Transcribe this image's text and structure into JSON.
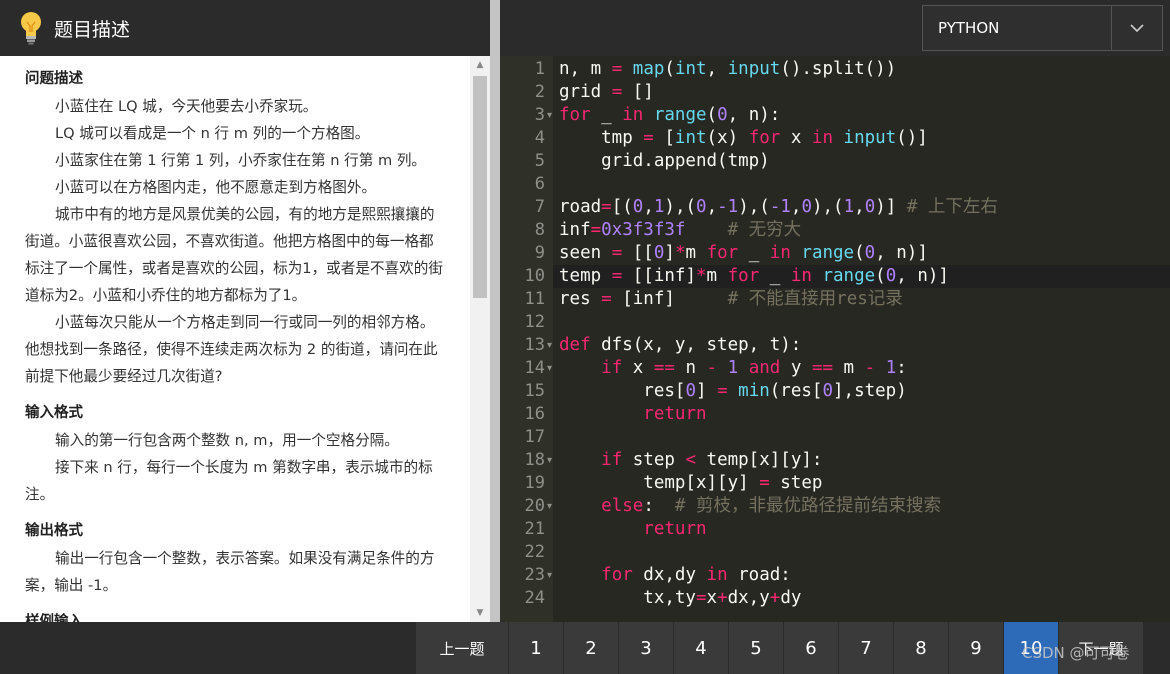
{
  "left_panel": {
    "title": "题目描述",
    "icon": "lightbulb-icon",
    "sections": {
      "problem": {
        "title": "问题描述",
        "paragraphs": [
          "小蓝住在 LQ 城，今天他要去小乔家玩。",
          "LQ 城可以看成是一个 n 行 m 列的一个方格图。",
          "小蓝家住在第 1 行第 1 列，小乔家住在第 n 行第 m 列。",
          "小蓝可以在方格图内走，他不愿意走到方格图外。",
          "城市中有的地方是风景优美的公园，有的地方是熙熙攘攘的街道。小蓝很喜欢公园，不喜欢街道。他把方格图中的每一格都标注了一个属性，或者是喜欢的公园，标为1，或者是不喜欢的街道标为2。小蓝和小乔住的地方都标为了1。",
          "小蓝每次只能从一个方格走到同一行或同一列的相邻方格。他想找到一条路径，使得不连续走两次标为 2 的街道，请问在此前提下他最少要经过几次街道?"
        ]
      },
      "input": {
        "title": "输入格式",
        "paragraphs": [
          "输入的第一行包含两个整数 n, m，用一个空格分隔。",
          "接下来 n 行，每行一个长度为 m 第数字串，表示城市的标注。"
        ]
      },
      "output": {
        "title": "输出格式",
        "paragraphs": [
          "输出一行包含一个整数，表示答案。如果没有满足条件的方案，输出 -1。"
        ]
      },
      "sample": {
        "title": "样例输入"
      }
    }
  },
  "editor": {
    "language": "PYTHON",
    "active_line": 10,
    "line_numbers": [
      "1",
      "2",
      "3",
      "4",
      "5",
      "6",
      "7",
      "8",
      "9",
      "10",
      "11",
      "12",
      "13",
      "14",
      "15",
      "16",
      "17",
      "18",
      "19",
      "20",
      "21",
      "22",
      "23",
      "24"
    ],
    "fold_lines": [
      3,
      13,
      14,
      18,
      20,
      23
    ],
    "lines": [
      [
        [
          "n, m ",
          ""
        ],
        [
          "=",
          "op"
        ],
        [
          " ",
          ""
        ],
        [
          "map",
          "fn"
        ],
        [
          "(",
          ""
        ],
        [
          "int",
          "fn"
        ],
        [
          ", ",
          ""
        ],
        [
          "input",
          "fn"
        ],
        [
          "().split())",
          ""
        ]
      ],
      [
        [
          "grid ",
          ""
        ],
        [
          "=",
          "op"
        ],
        [
          " []",
          ""
        ]
      ],
      [
        [
          "for",
          "kw"
        ],
        [
          " _ ",
          ""
        ],
        [
          "in",
          "kw"
        ],
        [
          " ",
          ""
        ],
        [
          "range",
          "fn"
        ],
        [
          "(",
          ""
        ],
        [
          "0",
          "num"
        ],
        [
          ", n):",
          ""
        ]
      ],
      [
        [
          "    tmp ",
          ""
        ],
        [
          "=",
          "op"
        ],
        [
          " [",
          ""
        ],
        [
          "int",
          "fn"
        ],
        [
          "(x) ",
          ""
        ],
        [
          "for",
          "kw"
        ],
        [
          " x ",
          ""
        ],
        [
          "in",
          "kw"
        ],
        [
          " ",
          ""
        ],
        [
          "input",
          "fn"
        ],
        [
          "()]",
          ""
        ]
      ],
      [
        [
          "    grid.append(tmp)",
          ""
        ]
      ],
      [
        [
          "",
          ""
        ]
      ],
      [
        [
          "road",
          ""
        ],
        [
          "=",
          "op"
        ],
        [
          "[(",
          ""
        ],
        [
          "0",
          "num"
        ],
        [
          ",",
          ""
        ],
        [
          "1",
          "num"
        ],
        [
          "),(",
          ""
        ],
        [
          "0",
          "num"
        ],
        [
          ",",
          ""
        ],
        [
          "-1",
          "num"
        ],
        [
          "),(",
          ""
        ],
        [
          "-1",
          "num"
        ],
        [
          ",",
          ""
        ],
        [
          "0",
          "num"
        ],
        [
          "),(",
          ""
        ],
        [
          "1",
          "num"
        ],
        [
          ",",
          ""
        ],
        [
          "0",
          "num"
        ],
        [
          ")] ",
          ""
        ],
        [
          "# 上下左右",
          "cm"
        ]
      ],
      [
        [
          "inf",
          ""
        ],
        [
          "=",
          "op"
        ],
        [
          "0x3f3f3f",
          "num"
        ],
        [
          "    ",
          ""
        ],
        [
          "# 无穷大",
          "cm"
        ]
      ],
      [
        [
          "seen ",
          ""
        ],
        [
          "=",
          "op"
        ],
        [
          " [[",
          ""
        ],
        [
          "0",
          "num"
        ],
        [
          "]",
          ""
        ],
        [
          "*",
          "op"
        ],
        [
          "m ",
          ""
        ],
        [
          "for",
          "kw"
        ],
        [
          " _ ",
          ""
        ],
        [
          "in",
          "kw"
        ],
        [
          " ",
          ""
        ],
        [
          "range",
          "fn"
        ],
        [
          "(",
          ""
        ],
        [
          "0",
          "num"
        ],
        [
          ", n)]",
          ""
        ]
      ],
      [
        [
          "temp ",
          ""
        ],
        [
          "=",
          "op"
        ],
        [
          " [[inf]",
          ""
        ],
        [
          "*",
          "op"
        ],
        [
          "m ",
          ""
        ],
        [
          "for",
          "kw"
        ],
        [
          " _ ",
          ""
        ],
        [
          "in",
          "kw"
        ],
        [
          " ",
          ""
        ],
        [
          "range",
          "fn"
        ],
        [
          "(",
          ""
        ],
        [
          "0",
          "num"
        ],
        [
          ", n)]",
          ""
        ]
      ],
      [
        [
          "res ",
          ""
        ],
        [
          "=",
          "op"
        ],
        [
          " [inf]     ",
          ""
        ],
        [
          "# 不能直接用res记录",
          "cm"
        ]
      ],
      [
        [
          "",
          ""
        ]
      ],
      [
        [
          "def",
          "kw"
        ],
        [
          " dfs(x, y, step, t):",
          ""
        ]
      ],
      [
        [
          "    ",
          ""
        ],
        [
          "if",
          "kw"
        ],
        [
          " x ",
          ""
        ],
        [
          "==",
          "op"
        ],
        [
          " n ",
          ""
        ],
        [
          "-",
          "op"
        ],
        [
          " ",
          ""
        ],
        [
          "1",
          "num"
        ],
        [
          " ",
          ""
        ],
        [
          "and",
          "kw"
        ],
        [
          " y ",
          ""
        ],
        [
          "==",
          "op"
        ],
        [
          " m ",
          ""
        ],
        [
          "-",
          "op"
        ],
        [
          " ",
          ""
        ],
        [
          "1",
          "num"
        ],
        [
          ":",
          ""
        ]
      ],
      [
        [
          "        res[",
          ""
        ],
        [
          "0",
          "num"
        ],
        [
          "] ",
          ""
        ],
        [
          "=",
          "op"
        ],
        [
          " ",
          ""
        ],
        [
          "min",
          "fn"
        ],
        [
          "(res[",
          ""
        ],
        [
          "0",
          "num"
        ],
        [
          "],step)",
          ""
        ]
      ],
      [
        [
          "        ",
          ""
        ],
        [
          "return",
          "kw"
        ]
      ],
      [
        [
          "",
          ""
        ]
      ],
      [
        [
          "    ",
          ""
        ],
        [
          "if",
          "kw"
        ],
        [
          " step ",
          ""
        ],
        [
          "<",
          "op"
        ],
        [
          " temp[x][y]:",
          ""
        ]
      ],
      [
        [
          "        temp[x][y] ",
          ""
        ],
        [
          "=",
          "op"
        ],
        [
          " step",
          ""
        ]
      ],
      [
        [
          "    ",
          ""
        ],
        [
          "else",
          "kw"
        ],
        [
          ":  ",
          ""
        ],
        [
          "# 剪枝，非最优路径提前结束搜索",
          "cm"
        ]
      ],
      [
        [
          "        ",
          ""
        ],
        [
          "return",
          "kw"
        ]
      ],
      [
        [
          "",
          ""
        ]
      ],
      [
        [
          "    ",
          ""
        ],
        [
          "for",
          "kw"
        ],
        [
          " dx,dy ",
          ""
        ],
        [
          "in",
          "kw"
        ],
        [
          " road:",
          ""
        ]
      ],
      [
        [
          "        tx,ty",
          ""
        ],
        [
          "=",
          "op"
        ],
        [
          "x",
          ""
        ],
        [
          "+",
          "op"
        ],
        [
          "dx,y",
          ""
        ],
        [
          "+",
          "op"
        ],
        [
          "dy",
          ""
        ]
      ]
    ]
  },
  "bottom_nav": {
    "prev_label": "上一题",
    "pages": [
      "1",
      "2",
      "3",
      "4",
      "5",
      "6",
      "7",
      "8",
      "9",
      "10"
    ],
    "active_page": "10",
    "next_label": "下一题"
  },
  "watermark": "CSDN @可可卷"
}
